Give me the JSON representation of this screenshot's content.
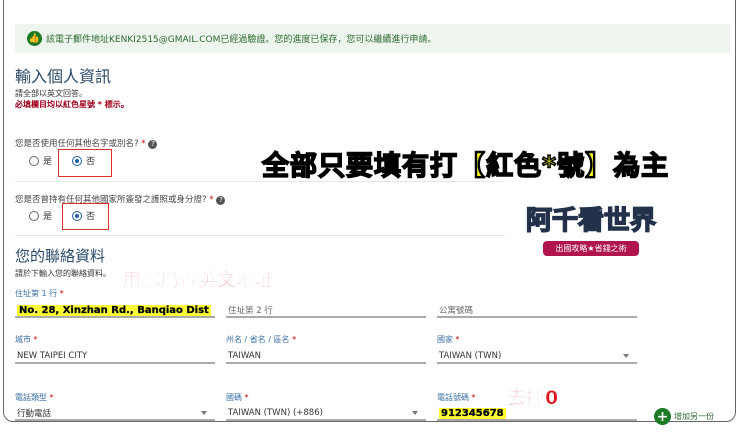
{
  "banner": {
    "icon": "thumbs-up-icon",
    "text": "該電子郵件地址KENKI2515@GMAIL.COM已經過驗證。您的進度已保存，您可以繼續進行申請。"
  },
  "personal": {
    "title": "輸入個人資訊",
    "instruction": "請全部以英文回答。",
    "required_note": "必填欄目均以紅色星號 * 標示。"
  },
  "questions": [
    {
      "label": "您是否使用任何其他名字或別名?",
      "star": "*",
      "options": [
        "是",
        "否"
      ],
      "selected": "否"
    },
    {
      "label": "您是否曾持有任何其他國家所簽發之護照或身分證?",
      "star": "*",
      "options": [
        "是",
        "否"
      ],
      "selected": "否"
    }
  ],
  "contact": {
    "title": "您的聯絡資料",
    "instruction": "請於下輸入您的聯絡資料。",
    "address1": {
      "label": "住址第 1 行",
      "star": "*",
      "value": "No. 28, Xinzhan Rd., Banqiao Dist"
    },
    "address2": {
      "placeholder": "住址第 2 行"
    },
    "apartment": {
      "placeholder": "公寓號碼"
    },
    "city": {
      "label": "城市",
      "star": "*",
      "value": "NEW TAIPEI CITY"
    },
    "state": {
      "label": "州名 / 省名 / 區名",
      "star": "*",
      "value": "TAIWAN"
    },
    "country": {
      "label": "國家",
      "star": "*",
      "value": "TAIWAN (TWN)"
    },
    "phone_type": {
      "label": "電話類型",
      "star": "*",
      "value": "行動電話"
    },
    "country_code": {
      "label": "國碼",
      "star": "*",
      "value": "TAIWAN (TWN) (+886)"
    },
    "phone": {
      "label": "電話號碼",
      "star": "*",
      "value": "912345678"
    },
    "add_another": "增加另一份"
  },
  "annotations": {
    "main": "全部只要填有打【紅色*號】為主",
    "address": "用郵局查英文地址",
    "phone": "去掉0"
  },
  "logo": {
    "title_a": "阿千",
    "title_b": "看世界",
    "tagline": "出國攻略★省錢之術"
  }
}
